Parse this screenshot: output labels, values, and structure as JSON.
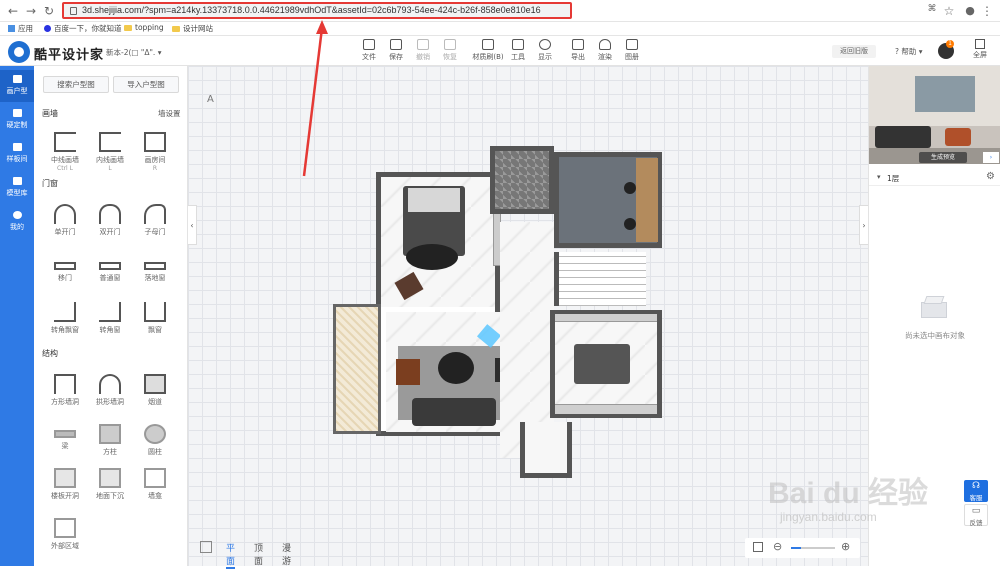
{
  "browser": {
    "url": "3d.shejijia.com/?spm=a214ky.13373718.0.0.44621989vdhOdT&assetId=02c6b793-54ee-424c-b26f-858e0e810e16",
    "bookmarks": [
      "应用",
      "百度一下，你就知道",
      "topping",
      "设计网站"
    ]
  },
  "app": {
    "brand": "酷平设计家",
    "doc_title": "新本-2(□ \"Δ\".",
    "toolbar": [
      {
        "label": "文件",
        "enabled": true
      },
      {
        "label": "保存",
        "enabled": true
      },
      {
        "label": "撤销",
        "enabled": false
      },
      {
        "label": "恢复",
        "enabled": false
      },
      {
        "label": "材质刷(B)",
        "enabled": true
      },
      {
        "label": "工具",
        "enabled": true
      },
      {
        "label": "显示",
        "enabled": true
      },
      {
        "label": "导出",
        "enabled": true
      },
      {
        "label": "渲染",
        "enabled": true
      },
      {
        "label": "图册",
        "enabled": true
      }
    ],
    "back_to_2d": "返回旧版",
    "help": "帮助",
    "avatar_badge": "1",
    "fullscreen": "全屏"
  },
  "rail": [
    {
      "label": "画户型",
      "active": true
    },
    {
      "label": "硬定制",
      "active": false
    },
    {
      "label": "样板间",
      "active": false
    },
    {
      "label": "模型库",
      "active": false
    },
    {
      "label": "我的",
      "active": false
    }
  ],
  "sidebar": {
    "search_button": "搜索户型图",
    "import_button": "导入户型图",
    "walls": {
      "title": "画墙",
      "settings": "墙设置",
      "items": [
        {
          "label": "中线画墙",
          "sub": "Ctrl L"
        },
        {
          "label": "内线画墙",
          "sub": "L"
        },
        {
          "label": "画房间",
          "sub": "R"
        }
      ]
    },
    "doors": {
      "title": "门窗",
      "items": [
        "单开门",
        "双开门",
        "子母门",
        "移门",
        "普通窗",
        "落地窗",
        "转角飘窗",
        "转角窗",
        "飘窗"
      ]
    },
    "structure": {
      "title": "结构",
      "items": [
        "方形墙洞",
        "拱形墙洞",
        "烟道",
        "梁",
        "方柱",
        "圆柱",
        "楼板开洞",
        "地面下沉",
        "墙龛",
        "外部区域"
      ]
    }
  },
  "canvas": {
    "north": "A",
    "view_modes": [
      "平面",
      "顶面",
      "漫游"
    ],
    "active_view": "平面"
  },
  "right_panel": {
    "preview_label": "生成预览",
    "floor": "1层",
    "empty_message": "尚未选中画布对象"
  },
  "floating": {
    "service": "客服",
    "feedback": "反馈"
  },
  "watermark": {
    "text": "Bai du 经验",
    "url": "jingyan.baidu.com"
  },
  "colors": {
    "accent": "#2f7ae5",
    "highlight": "#e53935"
  }
}
